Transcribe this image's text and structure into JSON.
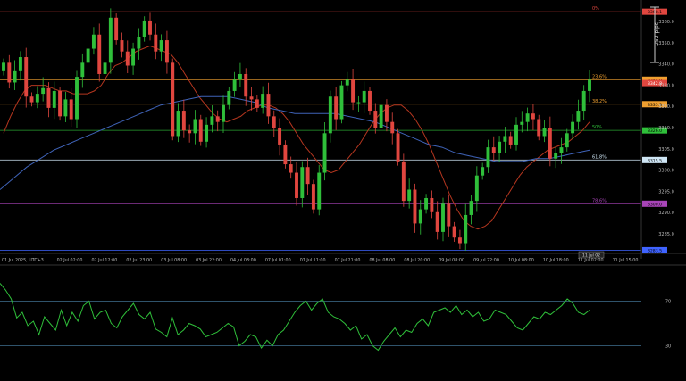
{
  "chart_data": [
    {
      "type": "candlestick",
      "symbol_hint": "XAUUSD",
      "timeframe_label": "",
      "ylim": [
        3283,
        3371
      ],
      "colors": {
        "up": "#2fbf3a",
        "down": "#e0463f",
        "ma_fast": "#b5361f",
        "ma_slow": "#3f63b8",
        "grid": "#1c1c1c"
      },
      "price_ticks": [
        "3360.0",
        "3350.0",
        "3340.0",
        "3330.0",
        "3320.0",
        "3310.0",
        "3305.0",
        "3300.0",
        "3295.0",
        "3290.0",
        "3285.0"
      ],
      "date_ticks": [
        "01 Jul 2025, UTC+3",
        "02 Jul 02:00",
        "02 Jul 12:00",
        "02 Jul 23:00",
        "03 Jul 08:00",
        "03 Jul 22:00",
        "04 Jul 08:00",
        "07 Jul 01:00",
        "07 Jul 11:00",
        "07 Jul 21:00",
        "08 Jul 08:00",
        "08 Jul 20:00",
        "09 Jul 08:00",
        "09 Jul 22:00",
        "10 Jul 08:00",
        "10 Jul 18:00",
        "11 Jul 02:00",
        "11 Jul 15:00"
      ],
      "vertical_axis_tag": "252 pips",
      "current_price_tag": "3342.8",
      "time_tag": "11 Jul 02",
      "fib_levels": [
        {
          "label": "0%",
          "price": 3368.1,
          "color": "#e0463f",
          "tag": "3368.1"
        },
        {
          "label": "23.6%",
          "price": 3344.0,
          "color": "#f0a030",
          "tag": "3344.0"
        },
        {
          "label": "38.2%",
          "price": 3335.3,
          "color": "#f0a030",
          "tag": "3335.3"
        },
        {
          "label": "50%",
          "price": 3326.0,
          "color": "#2fbf3a",
          "tag": "3326.0"
        },
        {
          "label": "61.8%",
          "price": 3315.5,
          "color": "#cfe6f5",
          "tag": "3315.5"
        },
        {
          "label": "78.6%",
          "price": 3300.0,
          "color": "#a844b8",
          "tag": "3300.0"
        },
        {
          "label": "",
          "price": 3283.5,
          "color": "#3f63ff",
          "tag": "3283.5"
        }
      ],
      "close_path": [
        3350,
        3343,
        3347,
        3352,
        3338,
        3336,
        3339,
        3341,
        3334,
        3340,
        3331,
        3337,
        3330,
        3345,
        3350,
        3355,
        3360,
        3346,
        3350,
        3366,
        3358,
        3354,
        3349,
        3355,
        3359,
        3365,
        3360,
        3354,
        3358,
        3350,
        3324,
        3333,
        3326,
        3325,
        3330,
        3322,
        3328,
        3331,
        3329,
        3335,
        3340,
        3344,
        3346,
        3338,
        3337,
        3334,
        3339,
        3331,
        3327,
        3321,
        3314,
        3311,
        3302,
        3313,
        3307,
        3298,
        3311,
        3325,
        3338,
        3330,
        3342,
        3344,
        3336,
        3336,
        3340,
        3333,
        3327,
        3335,
        3329,
        3325,
        3315,
        3301,
        3305,
        3293,
        3298,
        3302,
        3297,
        3290,
        3300,
        3292,
        3288,
        3286,
        3296,
        3301,
        3310,
        3313,
        3320,
        3318,
        3322,
        3324,
        3321,
        3328,
        3329,
        3332,
        3330,
        3324,
        3327,
        3316,
        3318,
        3320,
        3325,
        3329,
        3333,
        3340,
        3344
      ],
      "ma_fast": [
        3325,
        3331,
        3336,
        3340,
        3342,
        3342,
        3342,
        3341,
        3340,
        3340,
        3339,
        3339,
        3339,
        3340,
        3342,
        3346,
        3349,
        3350,
        3352,
        3354,
        3355,
        3356,
        3355,
        3354,
        3353,
        3350,
        3346,
        3342,
        3338,
        3335,
        3332,
        3330,
        3329,
        3330,
        3331,
        3333,
        3334,
        3335,
        3335,
        3334,
        3332,
        3329,
        3325,
        3321,
        3318,
        3315,
        3312,
        3311,
        3312,
        3315,
        3318,
        3321,
        3325,
        3329,
        3332,
        3334,
        3335,
        3335,
        3333,
        3330,
        3326,
        3321,
        3315,
        3309,
        3303,
        3298,
        3294,
        3292,
        3291,
        3292,
        3294,
        3298,
        3302,
        3306,
        3310,
        3313,
        3315,
        3317,
        3319,
        3320,
        3321,
        3322,
        3324,
        3326,
        3329
      ],
      "ma_slow": [
        3305,
        3309,
        3313,
        3316,
        3319,
        3321,
        3323,
        3325,
        3327,
        3329,
        3331,
        3333,
        3335,
        3336,
        3337,
        3338,
        3338,
        3338,
        3337,
        3336,
        3334,
        3333,
        3332,
        3332,
        3332,
        3332,
        3331,
        3330,
        3329,
        3327,
        3325,
        3323,
        3321,
        3320,
        3318,
        3317,
        3316,
        3315,
        3315,
        3315,
        3316,
        3316,
        3317,
        3318,
        3319
      ],
      "annotations": []
    },
    {
      "type": "line",
      "name": "RSI",
      "ylim": [
        0,
        100
      ],
      "levels": [
        {
          "label": "70",
          "value": 70,
          "color": "#3f6f8f"
        },
        {
          "label": "30",
          "value": 30,
          "color": "#3f6f8f"
        }
      ],
      "color": "#2fbf3a",
      "values": [
        86,
        80,
        72,
        55,
        60,
        48,
        52,
        40,
        56,
        50,
        44,
        62,
        48,
        60,
        52,
        66,
        70,
        54,
        60,
        62,
        50,
        46,
        56,
        62,
        68,
        58,
        54,
        60,
        45,
        42,
        38,
        55,
        40,
        44,
        50,
        48,
        45,
        38,
        40,
        42,
        46,
        50,
        47,
        30,
        34,
        40,
        38,
        28,
        35,
        30,
        40,
        44,
        52,
        60,
        66,
        70,
        62,
        68,
        72,
        60,
        56,
        54,
        50,
        44,
        48,
        36,
        40,
        30,
        26,
        34,
        40,
        46,
        38,
        44,
        42,
        50,
        54,
        48,
        60,
        62,
        64,
        60,
        66,
        58,
        62,
        56,
        60,
        52,
        54,
        62,
        60,
        58,
        52,
        46,
        44,
        50,
        56,
        54,
        60,
        58,
        62,
        66,
        72,
        68,
        60,
        58,
        62
      ]
    }
  ]
}
